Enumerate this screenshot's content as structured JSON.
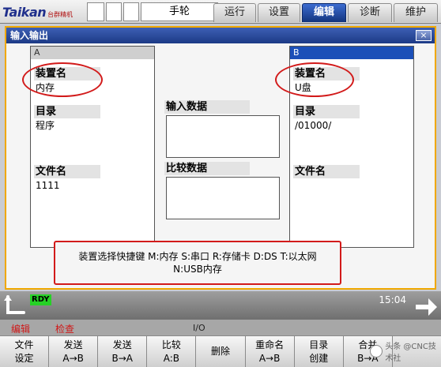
{
  "topbar": {
    "brand": "Taikan",
    "brand_sub": "台群精机",
    "mode": "手轮",
    "tabs": [
      {
        "label": "运行",
        "active": false
      },
      {
        "label": "设置",
        "active": false
      },
      {
        "label": "编辑",
        "active": true
      },
      {
        "label": "诊断",
        "active": false
      },
      {
        "label": "维护",
        "active": false
      }
    ]
  },
  "window": {
    "title": "输入输出",
    "close_glyph": "×",
    "panel_a": {
      "header": "A",
      "device_label": "装置名",
      "device_value": "内存",
      "dir_label": "目录",
      "dir_value": "程序",
      "file_label": "文件名",
      "file_value": "1111"
    },
    "panel_b": {
      "header": "B",
      "device_label": "装置名",
      "device_value": "U盘",
      "dir_label": "目录",
      "dir_value": "/01000/",
      "file_label": "文件名",
      "file_value": ""
    },
    "middle": {
      "input_label": "输入数据",
      "compare_label": "比较数据"
    },
    "hint_line1": "装置选择快捷键 M:内存 S:串口 R:存储卡 D:DS T:以太网",
    "hint_line2": "N:USB内存"
  },
  "status": {
    "rdy": "RDY",
    "time": "15:04",
    "back_icon": "back-arrow-icon",
    "next_icon": "next-arrow-icon",
    "mode_edit": "编辑",
    "mode_check": "检查",
    "io": "I/O"
  },
  "softkeys": [
    {
      "line1": "文件",
      "line2": "设定"
    },
    {
      "line1": "发送",
      "line2": "A→B"
    },
    {
      "line1": "发送",
      "line2": "B→A"
    },
    {
      "line1": "比较",
      "line2": "A:B"
    },
    {
      "line1": "删除",
      "line2": ""
    },
    {
      "line1": "重命名",
      "line2": "A→B"
    },
    {
      "line1": "目录",
      "line2": "创建"
    },
    {
      "line1": "合并",
      "line2": "B→A"
    },
    {
      "line1": "",
      "line2": ""
    }
  ],
  "watermark": "头条 @CNC技术社",
  "colors": {
    "active_tab": "#1b3f95",
    "window_border": "#f0a800",
    "highlight": "#d21a1a",
    "rdy": "#26d126"
  }
}
